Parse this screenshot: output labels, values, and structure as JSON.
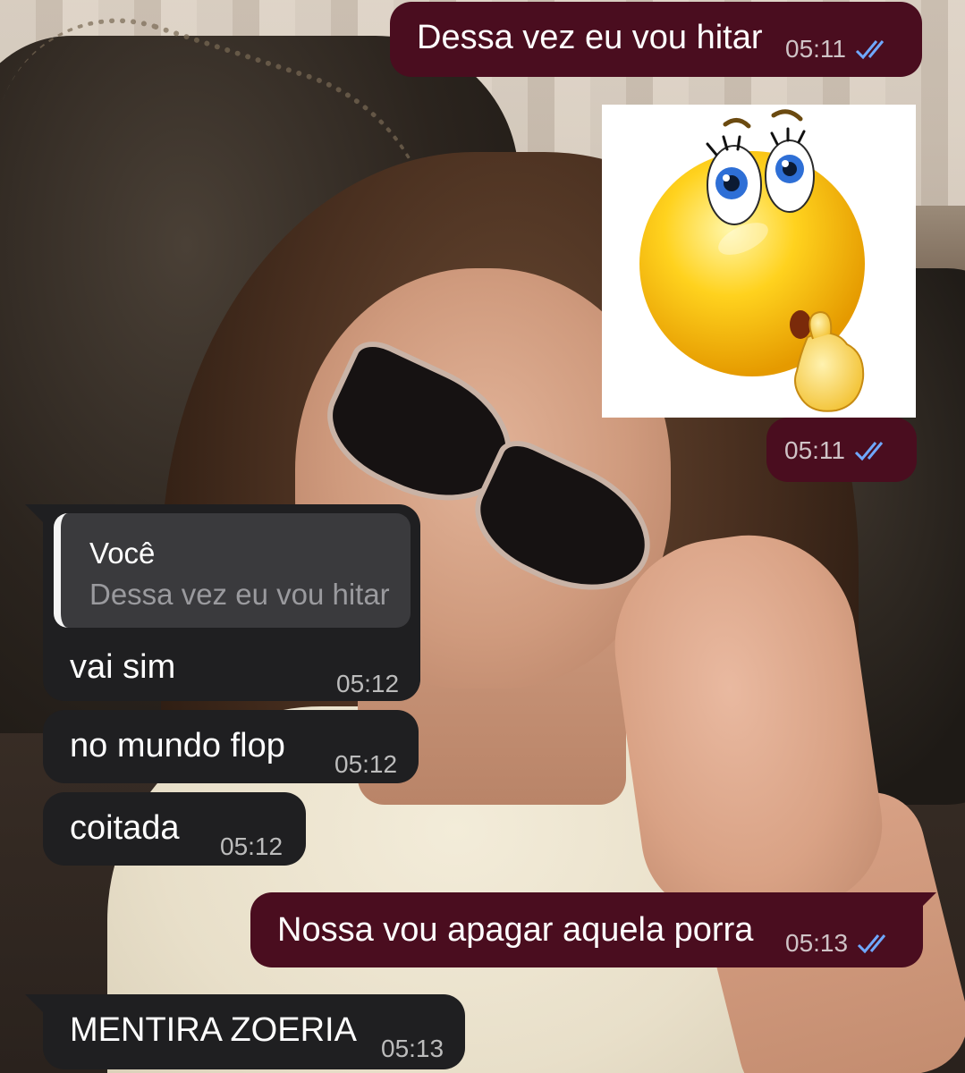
{
  "messages": {
    "m1": {
      "text": "Dessa vez eu vou hitar",
      "time": "05:11",
      "status": "read"
    },
    "m2": {
      "type": "sticker",
      "sticker_icon": "thinking-face-emoji-icon",
      "time": "05:11",
      "status": "read"
    },
    "m3": {
      "reply": {
        "author": "Você",
        "text": "Dessa vez eu vou hitar"
      },
      "text": "vai sim",
      "time": "05:12"
    },
    "m4": {
      "text": "no mundo flop",
      "time": "05:12"
    },
    "m5": {
      "text": "coitada",
      "time": "05:12"
    },
    "m6": {
      "text": "Nossa vou apagar aquela porra",
      "time": "05:13",
      "status": "read"
    },
    "m7": {
      "text": "MENTIRA ZOERIA",
      "time": "05:13"
    }
  },
  "colors": {
    "outgoing_bubble": "#4a0d1f",
    "incoming_bubble": "#1f1f21",
    "read_ticks": "#6fa8ff"
  }
}
